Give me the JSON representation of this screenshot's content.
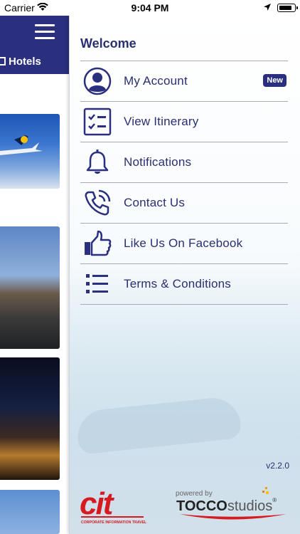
{
  "status_bar": {
    "carrier": "Carrier",
    "time": "9:04 PM",
    "battery_level": 0.85
  },
  "main": {
    "tab_label": "Hotels"
  },
  "drawer": {
    "heading": "Welcome",
    "items": [
      {
        "label": "My Account",
        "icon": "account-circle-icon",
        "badge": "New"
      },
      {
        "label": "View Itinerary",
        "icon": "checklist-icon"
      },
      {
        "label": "Notifications",
        "icon": "bell-icon"
      },
      {
        "label": "Contact Us",
        "icon": "phone-icon"
      },
      {
        "label": "Like Us On Facebook",
        "icon": "thumbs-up-icon"
      },
      {
        "label": "Terms & Conditions",
        "icon": "list-icon"
      }
    ],
    "version": "v2.2.0"
  },
  "branding": {
    "client_logo": "cit",
    "client_tagline": "CORPORATE INFORMATION TRAVEL",
    "powered_by": "powered by",
    "studio_name_bold": "TOCCO",
    "studio_name_light": "studios",
    "registered": "®"
  },
  "colors": {
    "primary": "#2a2f7e",
    "text": "#2a2f6f",
    "cit_red": "#d71920"
  }
}
